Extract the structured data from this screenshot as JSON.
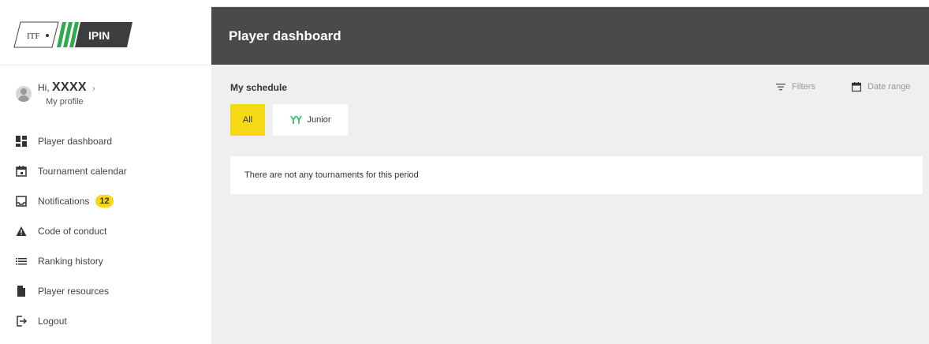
{
  "logo": {
    "itf_text": "ITF",
    "ipin_text": "IPIN"
  },
  "header": {
    "title": "Player dashboard"
  },
  "profile": {
    "greeting": "Hi,",
    "name": "XXXX",
    "chevron": "›",
    "link": "My profile"
  },
  "nav": {
    "items": [
      {
        "label": "Player dashboard",
        "icon": "dashboard-icon"
      },
      {
        "label": "Tournament calendar",
        "icon": "calendar-icon"
      },
      {
        "label": "Notifications",
        "icon": "inbox-icon",
        "badge": "12"
      },
      {
        "label": "Code of conduct",
        "icon": "warning-icon"
      },
      {
        "label": "Ranking history",
        "icon": "list-icon"
      },
      {
        "label": "Player resources",
        "icon": "document-icon"
      },
      {
        "label": "Logout",
        "icon": "logout-icon"
      }
    ]
  },
  "schedule": {
    "title": "My schedule",
    "filters_label": "Filters",
    "date_range_label": "Date range",
    "tabs": [
      {
        "label": "All",
        "active": true
      },
      {
        "label": "Junior",
        "active": false
      }
    ],
    "empty_message": "There are not any tournaments for this period"
  },
  "colors": {
    "header_bg": "#4a4a4a",
    "accent_yellow": "#f5d916",
    "junior_green": "#3cc36b",
    "logo_green": "#2fa84f",
    "main_bg": "#efefef"
  }
}
